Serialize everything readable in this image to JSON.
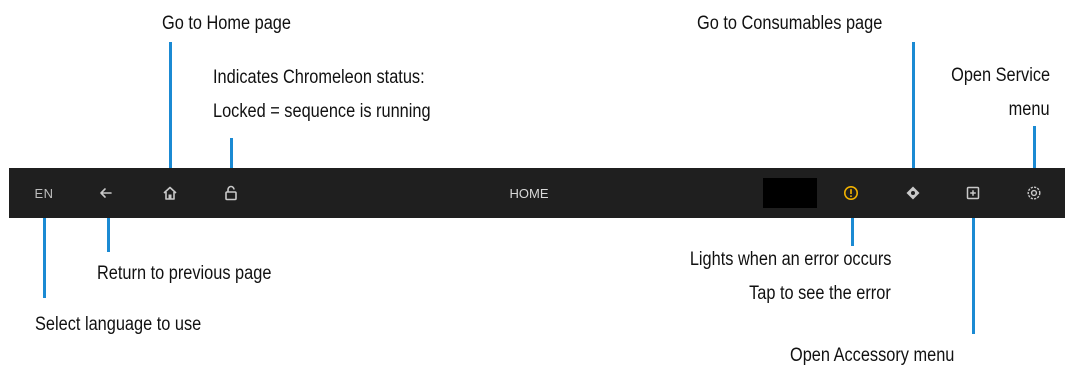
{
  "toolbar": {
    "language": "EN",
    "page_title": "HOME",
    "colors": {
      "background": "#1f1f1f",
      "icon": "#c9c9c9",
      "error": "#f2b200",
      "callout_line": "#1b8ad3"
    },
    "icons": [
      "back-arrow-icon",
      "home-icon",
      "unlock-icon",
      "error-icon",
      "consumables-icon",
      "accessory-icon",
      "settings-icon"
    ]
  },
  "callouts": {
    "home": "Go to Home page",
    "status_line1": "Indicates Chromeleon status:",
    "status_line2": "Locked = sequence is running",
    "consumables": "Go to Consumables page",
    "service_line1": "Open Service",
    "service_line2": "menu",
    "previous": "Return to previous page",
    "error_line1": "Lights when an error occurs",
    "error_line2": "Tap to see the error",
    "language": "Select language to use",
    "accessory": "Open Accessory menu"
  }
}
